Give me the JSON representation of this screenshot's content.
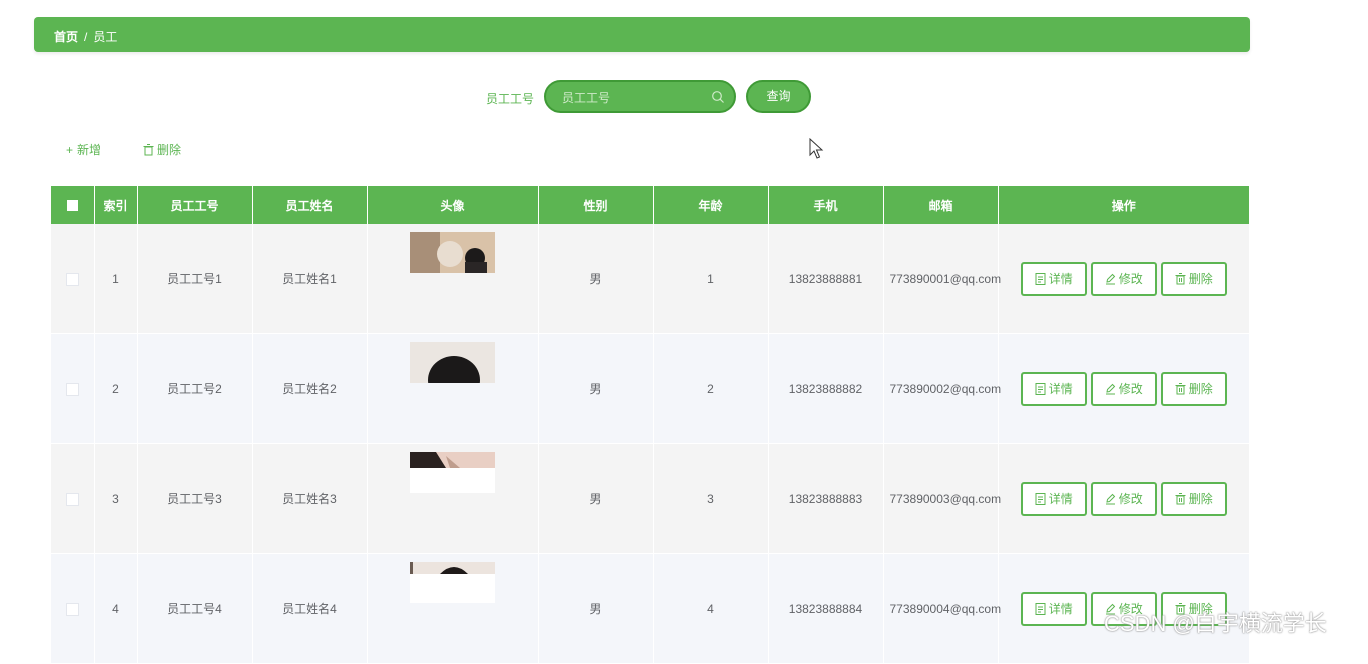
{
  "breadcrumb": {
    "home": "首页",
    "separator": "/",
    "current": "员工"
  },
  "search": {
    "label": "员工工号",
    "placeholder": "员工工号",
    "value": "",
    "button": "查询"
  },
  "actions": {
    "add": "新增",
    "add_icon": "+",
    "delete": "删除"
  },
  "table": {
    "columns": [
      "索引",
      "员工工号",
      "员工姓名",
      "头像",
      "性别",
      "年龄",
      "手机",
      "邮箱",
      "操作"
    ],
    "rows": [
      {
        "index": "1",
        "emp_no": "员工工号1",
        "name": "员工姓名1",
        "gender": "男",
        "age": "1",
        "phone": "13823888881",
        "email": "773890001@qq.com",
        "avatar_icon": "avatar-photo"
      },
      {
        "index": "2",
        "emp_no": "员工工号2",
        "name": "员工姓名2",
        "gender": "男",
        "age": "2",
        "phone": "13823888882",
        "email": "773890002@qq.com",
        "avatar_icon": "avatar-photo"
      },
      {
        "index": "3",
        "emp_no": "员工工号3",
        "name": "员工姓名3",
        "gender": "男",
        "age": "3",
        "phone": "13823888883",
        "email": "773890003@qq.com",
        "avatar_icon": "avatar-photo"
      },
      {
        "index": "4",
        "emp_no": "员工工号4",
        "name": "员工姓名4",
        "gender": "男",
        "age": "4",
        "phone": "13823888884",
        "email": "773890004@qq.com",
        "avatar_icon": "avatar-photo"
      }
    ],
    "row_ops": {
      "detail": "详情",
      "edit": "修改",
      "delete": "删除"
    }
  },
  "watermark": "CSDN @白宇横流学长",
  "colors": {
    "primary": "#5cb552",
    "primary_dark": "#3f9a36",
    "row_odd": "#f4f4f4",
    "row_even": "#f4f6fa"
  }
}
